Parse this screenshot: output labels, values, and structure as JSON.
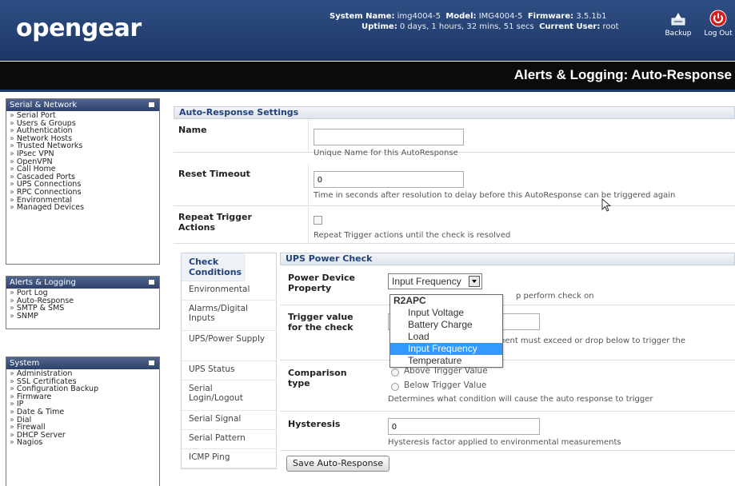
{
  "header": {
    "logo": "opengear",
    "system_name_label": "System Name:",
    "system_name": "img4004-5",
    "model_label": "Model:",
    "model": "IMG4004-5",
    "firmware_label": "Firmware:",
    "firmware": "3.5.1b1",
    "uptime_label": "Uptime:",
    "uptime": "0 days, 1 hours, 32 mins, 51 secs",
    "current_user_label": "Current User:",
    "current_user": "root",
    "backup_label": "Backup",
    "logout_label": "Log Out"
  },
  "page_title": "Alerts & Logging: Auto-Response",
  "sidebar": {
    "serial_network": {
      "title": "Serial & Network",
      "items": [
        "Serial Port",
        "Users & Groups",
        "Authentication",
        "Network Hosts",
        "Trusted Networks",
        "IPsec VPN",
        "OpenVPN",
        "Call Home",
        "Cascaded Ports",
        "UPS Connections",
        "RPC Connections",
        "Environmental",
        "Managed Devices"
      ]
    },
    "alerts_logging": {
      "title": "Alerts & Logging",
      "items": [
        "Port Log",
        "Auto-Response",
        "SMTP & SMS",
        "SNMP"
      ]
    },
    "system": {
      "title": "System",
      "items": [
        "Administration",
        "SSL Certificates",
        "Configuration Backup",
        "Firmware",
        "IP",
        "Date & Time",
        "Dial",
        "Firewall",
        "DHCP Server",
        "Nagios"
      ]
    }
  },
  "settings": {
    "title": "Auto-Response Settings",
    "name_label": "Name",
    "name_value": "",
    "name_hint": "Unique Name for this AutoResponse",
    "reset_label": "Reset Timeout",
    "reset_value": "0",
    "reset_hint": "Time in seconds after resolution to delay before this AutoResponse can be triggered again",
    "repeat_label": "Repeat Trigger Actions",
    "repeat_hint": "Repeat Trigger actions until the check is resolved"
  },
  "tabs": {
    "header": "Check Conditions",
    "items": [
      "Environmental",
      "Alarms/Digital Inputs",
      "UPS/Power Supply",
      "UPS Status",
      "Serial Login/Logout",
      "Serial Signal",
      "Serial Pattern",
      "ICMP Ping"
    ]
  },
  "ups": {
    "title": "UPS Power Check",
    "property_label": "Power Device Property",
    "property_selected": "Input Frequency",
    "property_hint_visible": "p perform check on",
    "trigger_label": "Trigger value for the check",
    "trigger_value": "",
    "trigger_hint_visible": "nent must exceed or drop below to trigger the",
    "comparison_label": "Comparison type",
    "above_label": "Above Trigger Value",
    "below_label": "Below Trigger Value",
    "comparison_hint": "Determines what condition will cause the auto response to trigger",
    "hysteresis_label": "Hysteresis",
    "hysteresis_value": "0",
    "hysteresis_hint": "Hysteresis factor applied to environmental measurements"
  },
  "dropdown": {
    "group": "R2APC",
    "options": [
      "Input Voltage",
      "Battery Charge",
      "Load",
      "Input Frequency",
      "Temperature"
    ],
    "selected_index": 3
  },
  "save_button": "Save Auto-Response",
  "colors": {
    "header_blue": "#2f4e83",
    "title_bar": "#0b0b0b",
    "link_blue": "#22437a",
    "selection": "#3399ff"
  }
}
